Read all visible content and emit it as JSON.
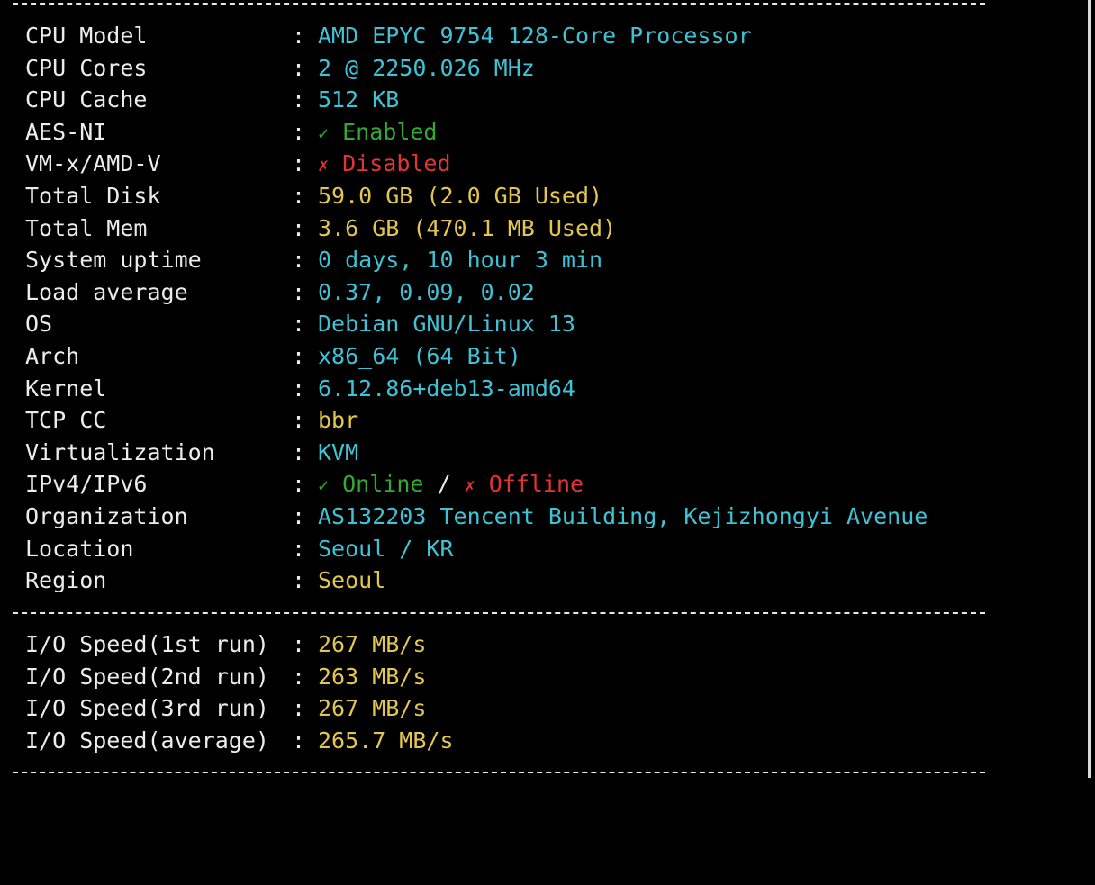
{
  "colors": {
    "cyan": "#3ec3d6",
    "yellow": "#e3c74c",
    "green": "#33a835",
    "red": "#e23434",
    "label": "#ececec"
  },
  "icons": {
    "enabled_icon": "check-icon",
    "disabled_icon": "cross-icon"
  },
  "separator": "----------------------------------------------------------------------",
  "sysinfo": [
    {
      "key": "CPU Model",
      "value": "AMD EPYC 9754 128-Core Processor"
    },
    {
      "key": "CPU Cores",
      "value": "2 @ 2250.026 MHz"
    },
    {
      "key": "CPU Cache",
      "value": "512 KB"
    },
    {
      "key": "AES-NI",
      "mark": "✓",
      "value": "Enabled"
    },
    {
      "key": "VM-x/AMD-V",
      "mark": "✗",
      "value": "Disabled"
    },
    {
      "key": "Total Disk",
      "value": "59.0 GB (2.0 GB Used)"
    },
    {
      "key": "Total Mem",
      "value": "3.6 GB (470.1 MB Used)"
    },
    {
      "key": "System uptime",
      "value": "0 days, 10 hour 3 min"
    },
    {
      "key": "Load average",
      "value": "0.37, 0.09, 0.02"
    },
    {
      "key": "OS",
      "value": "Debian GNU/Linux 13"
    },
    {
      "key": "Arch",
      "value": "x86_64 (64 Bit)"
    },
    {
      "key": "Kernel",
      "value": "6.12.86+deb13-amd64"
    },
    {
      "key": "TCP CC",
      "value": "bbr"
    },
    {
      "key": "Virtualization",
      "value": "KVM"
    },
    {
      "key": "IPv4/IPv6",
      "mark_ok": "✓",
      "value_ok": "Online",
      "slash": " / ",
      "mark_bad": "✗",
      "value_bad": "Offline"
    },
    {
      "key": "Organization",
      "value": "AS132203 Tencent Building, Kejizhongyi Avenue"
    },
    {
      "key": "Location",
      "value": "Seoul / KR"
    },
    {
      "key": "Region",
      "value": "Seoul"
    }
  ],
  "io": [
    {
      "key": "I/O Speed(1st run)",
      "value": "267 MB/s"
    },
    {
      "key": "I/O Speed(2nd run)",
      "value": "263 MB/s"
    },
    {
      "key": "I/O Speed(3rd run)",
      "value": "267 MB/s"
    },
    {
      "key": "I/O Speed(average)",
      "value": "265.7 MB/s"
    }
  ],
  "colon": ":"
}
